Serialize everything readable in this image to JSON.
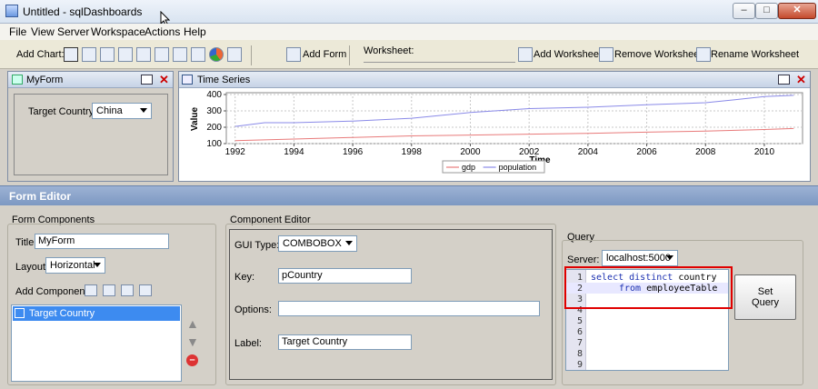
{
  "window": {
    "title": "Untitled - sqlDashboards"
  },
  "menu": [
    "File",
    "View",
    "Server",
    "Workspace",
    "Actions",
    "Help"
  ],
  "toolbar": {
    "add_chart_label": "Add Chart:",
    "add_form_label": "Add Form",
    "worksheet_label": "Worksheet:",
    "add_worksheet": "Add Worksheet",
    "remove_worksheet": "Remove Worksheet",
    "rename_worksheet": "Rename Worksheet"
  },
  "myform": {
    "title": "MyForm",
    "field_label": "Target Country",
    "field_value": "China"
  },
  "chart_panel": {
    "title": "Time Series"
  },
  "chart_data": {
    "type": "line",
    "xlabel": "Time",
    "ylabel": "Value",
    "x": [
      1992,
      2011
    ],
    "xticks": [
      1992,
      1994,
      1996,
      1998,
      2000,
      2002,
      2004,
      2006,
      2008,
      2010
    ],
    "yticks": [
      100,
      200,
      300,
      400
    ],
    "ylim": [
      100,
      400
    ],
    "xlim": [
      1991.7,
      2011.3
    ],
    "grid": true,
    "legend": "bottom",
    "series": [
      {
        "name": "gdp",
        "color": "#e87a7a",
        "points": [
          [
            1992,
            118
          ],
          [
            1994,
            128
          ],
          [
            1996,
            138
          ],
          [
            1998,
            147
          ],
          [
            2000,
            152
          ],
          [
            2002,
            158
          ],
          [
            2004,
            163
          ],
          [
            2006,
            170
          ],
          [
            2008,
            176
          ],
          [
            2010,
            186
          ],
          [
            2011,
            192
          ]
        ]
      },
      {
        "name": "population",
        "color": "#8a8ae8",
        "points": [
          [
            1992,
            205
          ],
          [
            1993,
            228
          ],
          [
            1994,
            228
          ],
          [
            1996,
            238
          ],
          [
            1998,
            255
          ],
          [
            2000,
            290
          ],
          [
            2002,
            314
          ],
          [
            2004,
            322
          ],
          [
            2006,
            338
          ],
          [
            2008,
            350
          ],
          [
            2009,
            368
          ],
          [
            2010,
            388
          ],
          [
            2011,
            395
          ]
        ]
      }
    ]
  },
  "form_editor": {
    "title": "Form Editor",
    "components_group": "Form Components",
    "title_label": "Title",
    "title_value": "MyForm",
    "layout_label": "Layout",
    "layout_value": "Horizontal",
    "add_component_label": "Add Component",
    "component_item": "Target Country"
  },
  "component_editor": {
    "group": "Component Editor",
    "gui_type_label": "GUI Type:",
    "gui_type_value": "COMBOBOX",
    "key_label": "Key:",
    "key_value": "pCountry",
    "options_label": "Options:",
    "options_value": "",
    "label_label": "Label:",
    "label_value": "Target Country"
  },
  "query": {
    "group": "Query",
    "server_label": "Server:",
    "server_value": "localhost:5000",
    "line_numbers": [
      "1",
      "2",
      "3",
      "4",
      "5",
      "6",
      "7",
      "8",
      "9"
    ],
    "code_line1_kw": "select distinct",
    "code_line1_rest": " country",
    "code_line2_kw": "from",
    "code_line2_rest": " employeeTable",
    "set_query_l1": "Set",
    "set_query_l2": "Query"
  }
}
